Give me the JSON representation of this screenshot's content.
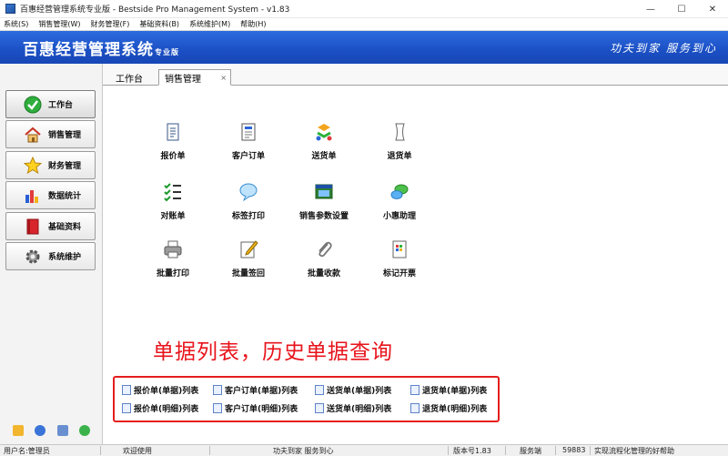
{
  "window": {
    "title": "百惠经营管理系统专业版 - Bestside Pro Management System - v1.83",
    "minimize": "—",
    "maximize": "☐",
    "close": "✕"
  },
  "menu": [
    "系统(S)",
    "销售管理(W)",
    "财务管理(F)",
    "基础资料(B)",
    "系统维护(M)",
    "帮助(H)"
  ],
  "header": {
    "brand": "百惠经营管理系统",
    "edition": "专业版",
    "slogan": "功夫到家 服务到心"
  },
  "sidebar": {
    "items": [
      {
        "label": "工作台",
        "icon": "check-circle-icon"
      },
      {
        "label": "销售管理",
        "icon": "house-icon"
      },
      {
        "label": "财务管理",
        "icon": "star-icon"
      },
      {
        "label": "数据统计",
        "icon": "bar-chart-icon"
      },
      {
        "label": "基础资料",
        "icon": "book-icon"
      },
      {
        "label": "系统维护",
        "icon": "gear-icon"
      }
    ]
  },
  "tabs": {
    "home": "工作台",
    "sales": "销售管理",
    "close": "×"
  },
  "functions": [
    {
      "label": "报价单",
      "icon": "quote-icon"
    },
    {
      "label": "客户订单",
      "icon": "order-icon"
    },
    {
      "label": "送货单",
      "icon": "delivery-icon"
    },
    {
      "label": "退货单",
      "icon": "return-icon"
    },
    {
      "label": "对账单",
      "icon": "reconcile-icon"
    },
    {
      "label": "标签打印",
      "icon": "label-print-icon"
    },
    {
      "label": "销售参数设置",
      "icon": "settings-window-icon"
    },
    {
      "label": "小惠助理",
      "icon": "assistant-icon"
    },
    {
      "label": "批量打印",
      "icon": "printer-icon"
    },
    {
      "label": "批量签回",
      "icon": "sign-icon"
    },
    {
      "label": "批量收款",
      "icon": "paperclip-icon"
    },
    {
      "label": "标记开票",
      "icon": "invoice-icon"
    }
  ],
  "note": "单据列表，历史单据查询",
  "list_links": [
    "报价单(单据)列表",
    "客户订单(单据)列表",
    "送货单(单据)列表",
    "退货单(单据)列表",
    "报价单(明细)列表",
    "客户订单(明细)列表",
    "送货单(明细)列表",
    "退货单(明细)列表"
  ],
  "status": {
    "user": "用户名:管理员",
    "welcome": "欢迎使用",
    "motto": "功夫到家 服务到心",
    "version": "版本号1.83",
    "server_label": "服务端",
    "server_port": "59883",
    "tip": "实现流程化管理的好帮助"
  },
  "colors": {
    "header_blue": "#1b4fc4",
    "note_red": "#e8131b",
    "box_red": "#e51d1d"
  }
}
